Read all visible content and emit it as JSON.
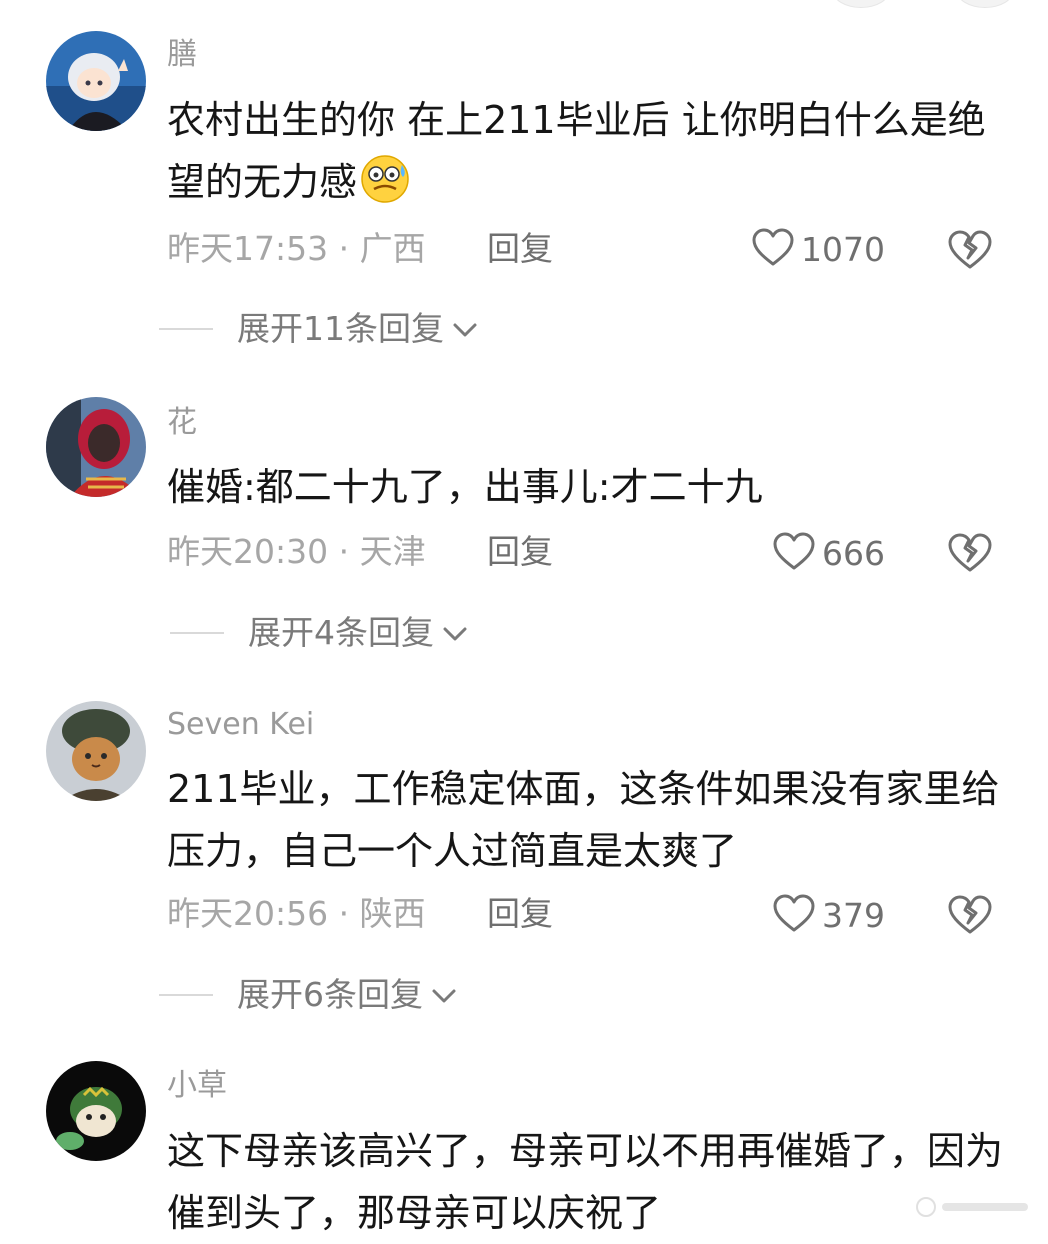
{
  "comments": [
    {
      "username": "膳",
      "text": "农村出生的你  在上211毕业后  让你明白什么是绝望的无力感",
      "emoji": "crying-sweat-emoji",
      "time": "昨天17:53",
      "location": "广西",
      "reply_label": "回复",
      "likes": "1070",
      "expand_label": "展开11条回复"
    },
    {
      "username": "花",
      "text": "催婚:都二十九了，出事儿:才二十九",
      "time": "昨天20:30",
      "location": "天津",
      "reply_label": "回复",
      "likes": "666",
      "expand_label": "展开4条回复"
    },
    {
      "username": "Seven Kei",
      "text": "211毕业，工作稳定体面，这条件如果没有家里给压力，自己一个人过简直是太爽了",
      "time": "昨天20:56",
      "location": "陕西",
      "reply_label": "回复",
      "likes": "379",
      "expand_label": "展开6条回复"
    },
    {
      "username": "小草",
      "text": "这下母亲该高兴了，母亲可以不用再催婚了，因为催到头了，那母亲可以庆祝了"
    }
  ],
  "separator": " · ",
  "icons": {
    "like": "heart-outline-icon",
    "dislike": "broken-heart-icon",
    "expand": "chevron-down-icon"
  },
  "colors": {
    "text": "#161616",
    "muted": "#a6a6a6",
    "username": "#9a9a9a",
    "action": "#6f6f6f"
  }
}
